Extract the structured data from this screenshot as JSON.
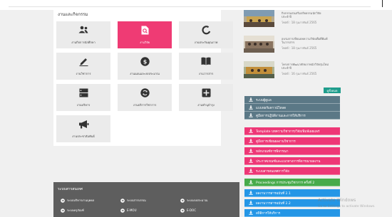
{
  "colors": {
    "accent_pink": "#ef3b74",
    "slate": "#5b7886",
    "green": "#47ab4b",
    "blue": "#2496e6",
    "teal": "#1f9d8c",
    "footer_bg": "#5e5e5e"
  },
  "panel": {
    "title": "งานและกิจกรรม",
    "tiles": [
      {
        "label": "งานกิจการนักศึกษา",
        "icon": "users-icon",
        "active": false
      },
      {
        "label": "งานวิจัย",
        "icon": "search-document-icon",
        "active": true
      },
      {
        "label": "งานประกันคุณภาพ",
        "icon": "circle-notch-icon",
        "active": false
      },
      {
        "label": "งานวิชาการ",
        "icon": "pen-icon",
        "active": false
      },
      {
        "label": "งานแผนและงบประมาณ",
        "icon": "dollar-icon",
        "active": false
      },
      {
        "label": "งานวารสาร",
        "icon": "book-icon",
        "active": false
      },
      {
        "label": "งานบริหาร",
        "icon": "server-icon",
        "active": false
      },
      {
        "label": "งานบริการวิชาการ",
        "icon": "refresh-icon",
        "active": false
      },
      {
        "label": "งานทำนุบำรุง",
        "icon": "plus-square-icon",
        "active": false
      },
      {
        "label": "งานประชาสัมพันธ์",
        "icon": "megaphone-icon",
        "active": false
      }
    ]
  },
  "news": {
    "items": [
      {
        "title": "กิจกรรมส่งเสริมจริยธรรมนักวิจัย",
        "subtitle": "ประจำปี",
        "date": "18 กุมภาพันธ์ 2565",
        "date_prefix": "โพสต์ :"
      },
      {
        "title": "อบรมการเขียนบทความวิจัยเพื่อตีพิมพ์",
        "subtitle": "ในวารสาร",
        "date": "18 กุมภาพันธ์ 2565",
        "date_prefix": "โพสต์ :"
      },
      {
        "title": "โครงการพัฒนาศักยภาพนักวิจัยรุ่นใหม่",
        "subtitle": "ประจำปี",
        "date": "16 กุมภาพันธ์ 2565",
        "date_prefix": "โพสต์ :"
      }
    ],
    "all_button": "ดูทั้งหมด"
  },
  "links": [
    {
      "label": "ระบบผู้ดูแล",
      "color": "slate"
    },
    {
      "label": "แบบฟอร์มดาวน์โหลด",
      "color": "slate"
    },
    {
      "label": "คู่มือการปฏิบัติงานและการให้บริการ",
      "color": "slate"
    },
    {
      "label": "Template บทความวิชาการ/วิจัย/พิมพ์เผยแพร่",
      "color": "pink"
    },
    {
      "label": "คู่มือการเขียนผลงานวิชาการ",
      "color": "pink"
    },
    {
      "label": "หลักเกณฑ์การพิจารณา",
      "color": "pink"
    },
    {
      "label": "ประกาศเกณฑ์และแนวทางการพิจารณาผลงาน",
      "color": "pink"
    },
    {
      "label": "ระบบสารสนเทศการวิจัย",
      "color": "pink"
    },
    {
      "label": "Proceedings การประชุมวิชาการ ครั้งที่ 2",
      "color": "green"
    },
    {
      "label": "ผลงานวารสารฉบับที่ 2.1",
      "color": "blue"
    },
    {
      "label": "ผลงานวารสารฉบับที่ 2.2",
      "color": "blue"
    },
    {
      "label": "สถิติการให้บริการ",
      "color": "blue"
    }
  ],
  "footer": {
    "title": "ระบบสารสนเทศ",
    "items": [
      {
        "label": "ระบบบริหารงานบุคคล"
      },
      {
        "label": "ระบบสารบรรณ"
      },
      {
        "label": "ระบบงบประมาณ"
      },
      {
        "label": "ระบบครุภัณฑ์"
      },
      {
        "label": "E-MOU"
      },
      {
        "label": "E-DOC"
      }
    ]
  },
  "watermark": {
    "line1": "Activate Windows",
    "line2": "Go to Settings to activate Windows."
  }
}
